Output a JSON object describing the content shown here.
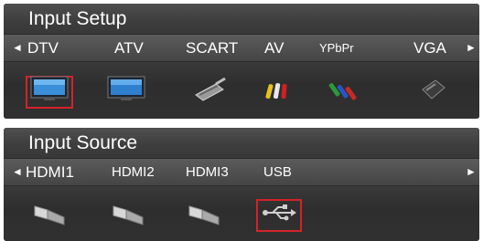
{
  "input_setup": {
    "title": "Input Setup",
    "left_arrow": "◄",
    "right_arrow": "►",
    "tabs": [
      "DTV",
      "ATV",
      "SCART",
      "AV",
      "YPbPr",
      "VGA"
    ],
    "selected": "DTV",
    "icons": [
      "tv-icon",
      "tv-icon",
      "scart-plug-icon",
      "av-rca-icon",
      "ypbpr-rca-icon",
      "vga-plug-icon"
    ]
  },
  "input_source": {
    "title": "Input Source",
    "left_arrow": "◄",
    "right_arrow": "►",
    "tabs": [
      "HDMI1",
      "HDMI2",
      "HDMI3",
      "USB"
    ],
    "selected": "USB",
    "icons": [
      "hdmi-plug-icon",
      "hdmi-plug-icon",
      "hdmi-plug-icon",
      "usb-icon"
    ]
  },
  "colors": {
    "selection": "#d3232a",
    "panel_dark": "#333333",
    "text": "#ffffff"
  }
}
